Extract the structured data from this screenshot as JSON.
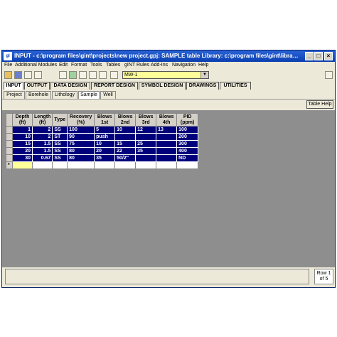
{
  "window": {
    "title": "INPUT - c:\\program files\\gint\\projects\\new project.gpj: SAMPLE table  Library: c:\\program files\\gint\\libraries\\...",
    "controls": {
      "minimize": "_",
      "maximize": "□",
      "close": "×"
    }
  },
  "menu": [
    "File",
    "Additional Modules",
    "Edit",
    "Format",
    "Tools",
    "Tables",
    "gINT Rules",
    "Add-Ins",
    "Navigation",
    "Help"
  ],
  "toolbar": {
    "combo_value": "MW-1",
    "combo_arrow": "▼"
  },
  "module_tabs": [
    "INPUT",
    "OUTPUT",
    "DATA DESIGN",
    "REPORT DESIGN",
    "SYMBOL DESIGN",
    "DRAWINGS",
    "UTILITIES"
  ],
  "sub_tabs": [
    "Project",
    "Borehole",
    "Lithology",
    "Sample",
    "Well"
  ],
  "table_help_label": "Table Help",
  "grid": {
    "headers": [
      [
        "Depth",
        "(ft)"
      ],
      [
        "Length",
        "(ft)"
      ],
      [
        "Type",
        ""
      ],
      [
        "Recovery",
        "(%)"
      ],
      [
        "Blows",
        "1st"
      ],
      [
        "Blows",
        "2nd"
      ],
      [
        "Blows",
        "3rd"
      ],
      [
        "Blows",
        "4th"
      ],
      [
        "PID",
        "(ppm)"
      ]
    ],
    "rows": [
      [
        "1",
        "2",
        "SS",
        "100",
        "5",
        "10",
        "12",
        "13",
        "100"
      ],
      [
        "10",
        "2",
        "ST",
        "90",
        "push",
        "",
        "",
        "",
        "200"
      ],
      [
        "15",
        "1.5",
        "SS",
        "75",
        "10",
        "15",
        "25",
        "",
        "300"
      ],
      [
        "20",
        "1.5",
        "SS",
        "80",
        "20",
        "22",
        "35",
        "",
        "400"
      ],
      [
        "30",
        "0.67",
        "SS",
        "80",
        "35",
        "50/2\"",
        "",
        "",
        "ND"
      ]
    ],
    "new_row_marker": "*"
  },
  "status": {
    "row_label": "Row 1",
    "row_of": "of 5"
  }
}
